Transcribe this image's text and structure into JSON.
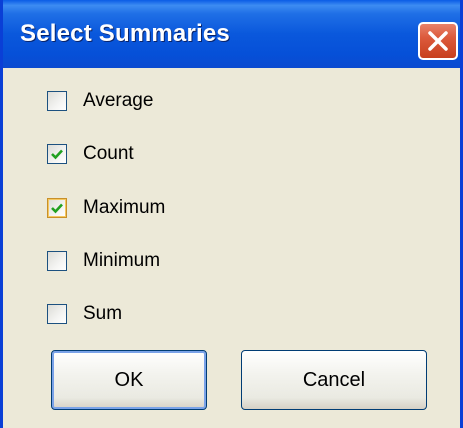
{
  "window": {
    "title": "Select Summaries"
  },
  "options": [
    {
      "label": "Average",
      "checked": false
    },
    {
      "label": "Count",
      "checked": true
    },
    {
      "label": "Maximum",
      "checked": true
    },
    {
      "label": "Minimum",
      "checked": false
    },
    {
      "label": "Sum",
      "checked": false
    }
  ],
  "buttons": {
    "ok_label": "OK",
    "cancel_label": "Cancel"
  },
  "icons": {
    "close": "close-icon",
    "check": "checkmark-icon"
  },
  "colors": {
    "titlebar": "#0a58dc",
    "close_button": "#dc5a3c",
    "checkmark": "#21a121",
    "dialog_background": "#ece9d8"
  }
}
